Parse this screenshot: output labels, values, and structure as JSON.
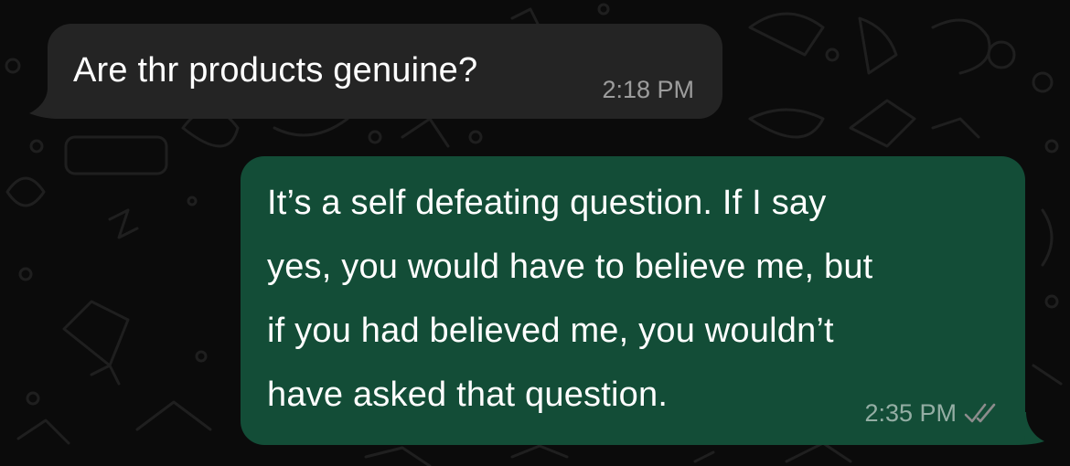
{
  "messages": [
    {
      "direction": "incoming",
      "text": "Are thr products genuine?",
      "time": "2:18 PM"
    },
    {
      "direction": "outgoing",
      "lines": [
        "It’s a self defeating question. If I say",
        "yes, you would have to believe me, but",
        "if you had believed me, you wouldn’t",
        "have asked that question."
      ],
      "time": "2:35 PM",
      "status_icon": "double-check-read-icon"
    }
  ],
  "colors": {
    "background": "#0b0b0b",
    "incoming_bubble": "#242424",
    "outgoing_bubble": "#134d37",
    "text": "#ffffff",
    "timestamp": "#8c8c8c"
  }
}
